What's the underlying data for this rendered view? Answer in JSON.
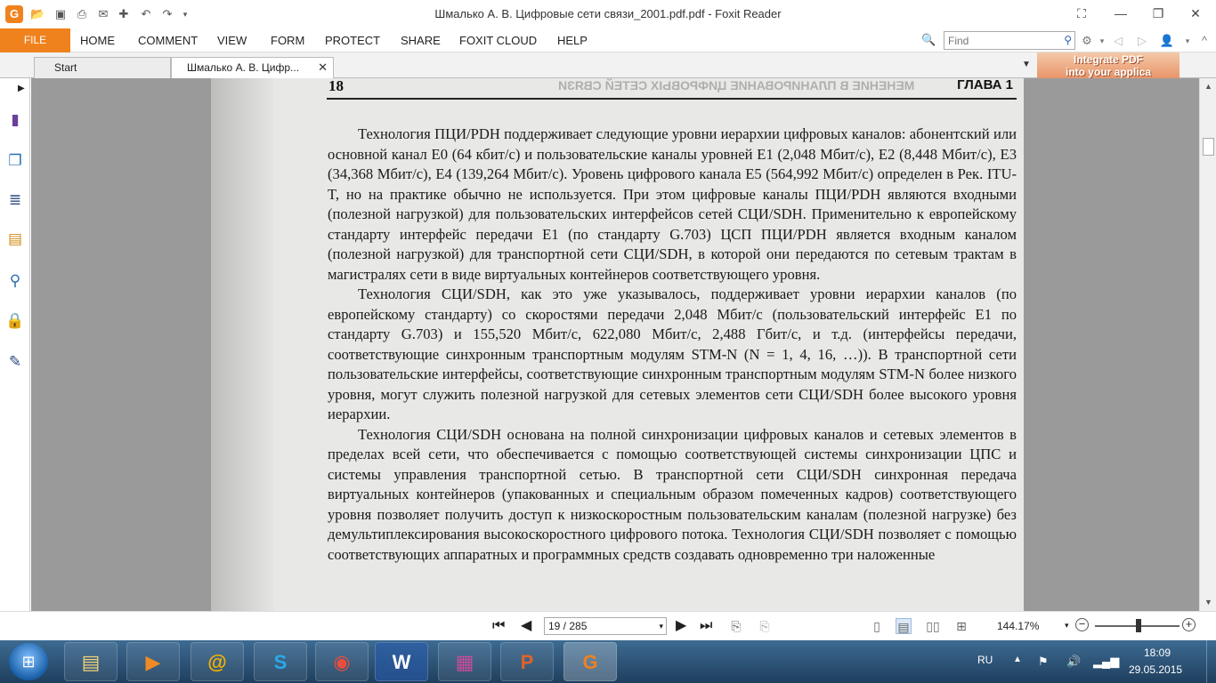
{
  "window": {
    "title": "Шмалько А. В. Цифровые сети связи_2001.pdf.pdf - Foxit Reader",
    "app_logo_letter": "G"
  },
  "quick_access": {
    "icons": [
      "open-folder-icon",
      "save-icon",
      "print-icon",
      "email-icon",
      "new-icon",
      "undo-icon",
      "redo-icon",
      "customize-dropdown-icon"
    ]
  },
  "ribbon": {
    "file": "FILE",
    "tabs": [
      "HOME",
      "COMMENT",
      "VIEW",
      "FORM",
      "PROTECT",
      "SHARE",
      "FOXIT CLOUD",
      "HELP"
    ]
  },
  "find": {
    "placeholder": "Find"
  },
  "doc_tabs": [
    {
      "label": "Start"
    },
    {
      "label": "Шмалько А. В. Цифр..."
    }
  ],
  "ad": {
    "line1": "Integrate PDF",
    "line2": "into your applica"
  },
  "sidebar": {
    "icons": [
      "bookmarks-icon",
      "pages-icon",
      "layers-icon",
      "comments-icon",
      "attachments-icon",
      "security-icon",
      "signature-icon"
    ]
  },
  "document_page": {
    "page_number": "18",
    "chapter": "ГЛАВА 1",
    "bleed_through": "МЕНЕНИЕ В ПЛАНИРОВАНИЕ ЦИФРОВЫХ СЕТЕЙ СВЯЗИ",
    "paragraphs": [
      "Технология ПЦИ/PDH поддерживает следующие уровни иерархии цифровых каналов: абонентский или основной канал E0 (64 кбит/с) и пользовательские каналы уровней E1 (2,048 Мбит/с), E2 (8,448 Мбит/с), E3 (34,368 Мбит/с), E4 (139,264 Мбит/с). Уровень цифрового канала E5 (564,992 Мбит/с) определен в Рек. ITU-T, но на практике обычно не используется. При этом цифровые каналы ПЦИ/PDH являются входными (полезной нагрузкой) для пользовательских интерфейсов сетей СЦИ/SDH. Применительно к европейскому стандарту интерфейс передачи E1 (по стандарту G.703) ЦСП ПЦИ/PDH является входным каналом (полезной нагрузкой) для транспортной сети СЦИ/SDH, в которой они передаются по сетевым трактам в магистралях сети в виде виртуальных контейнеров соответствующего уровня.",
      "Технология СЦИ/SDH, как это уже указывалось, поддерживает уровни иерархии каналов (по европейскому стандарту) со скоростями передачи 2,048 Мбит/с (пользовательский интерфейс E1 по стандарту G.703) и 155,520 Мбит/с, 622,080 Мбит/с, 2,488 Гбит/с, и т.д. (интерфейсы передачи, соответствующие синхронным транспортным модулям STM-N (N = 1, 4, 16, …)). В транспортной сети пользовательские интерфейсы, соответствующие синхронным транспортным модулям STM-N более низкого уровня, могут служить полезной нагрузкой для сетевых элементов сети СЦИ/SDH более высокого уровня иерархии.",
      "Технология СЦИ/SDH основана на полной синхронизации цифровых каналов и сетевых элементов в пределах всей сети, что обеспечивается с помощью соответствующей системы синхронизации ЦПС и системы управления транспортной сетью. В транспортной сети СЦИ/SDH синхронная передача виртуальных контейнеров (упакованных и специальным образом помеченных кадров) соответствующего уровня позволяет получить доступ к низкоскоростным пользовательским каналам (полезной нагрузке) без демультиплексирования высокоскоростного цифрового потока. Технология СЦИ/SDH позволяет с помощью соответствующих аппаратных и программных средств создавать одновременно три наложенные"
    ]
  },
  "status_bar": {
    "page_field": "19 / 285",
    "zoom": "144.17%",
    "zoom_slider_fraction": 0.5
  },
  "taskbar": {
    "apps": [
      {
        "name": "file-explorer",
        "glyph": "▤"
      },
      {
        "name": "media-player",
        "glyph": "▶"
      },
      {
        "name": "mail-agent",
        "glyph": "@"
      },
      {
        "name": "skype",
        "glyph": "S"
      },
      {
        "name": "chrome",
        "glyph": "◉"
      },
      {
        "name": "word",
        "glyph": "W"
      },
      {
        "name": "winrar",
        "glyph": "▦"
      },
      {
        "name": "powerpoint",
        "glyph": "P"
      },
      {
        "name": "foxit-pdf",
        "glyph": "G"
      }
    ],
    "language": "RU",
    "time": "18:09",
    "date": "29.05.2015"
  },
  "colors": {
    "accent_orange": "#f0821e",
    "taskbar_blue": "#2c5478",
    "doc_background": "#9a9a9a"
  }
}
